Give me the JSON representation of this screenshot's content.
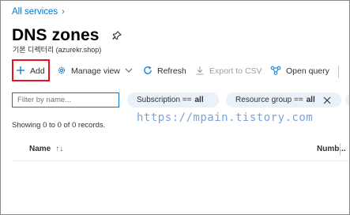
{
  "breadcrumb": {
    "link": "All services"
  },
  "header": {
    "title": "DNS zones",
    "subtitle": "기본 디렉터리 (azurekr.shop)"
  },
  "toolbar": {
    "add": "Add",
    "manage_view": "Manage view",
    "refresh": "Refresh",
    "export_csv": "Export to CSV",
    "open_query": "Open query"
  },
  "filters": {
    "search_placeholder": "Filter by name...",
    "subscription": {
      "label": "Subscription ==",
      "value": "all"
    },
    "resource_group": {
      "label": "Resource group ==",
      "value": "all"
    }
  },
  "watermark": "https://mpain.tistory.com",
  "status": {
    "records": "Showing 0 to 0 of 0 records."
  },
  "table": {
    "columns": [
      {
        "label": "Name",
        "sort": "↑↓"
      },
      {
        "label": "Numb..."
      }
    ]
  },
  "colors": {
    "accent": "#0078d4",
    "highlight_border": "#e81123",
    "pill_bg": "#eaf1fb",
    "disabled_text": "#a19f9d"
  }
}
